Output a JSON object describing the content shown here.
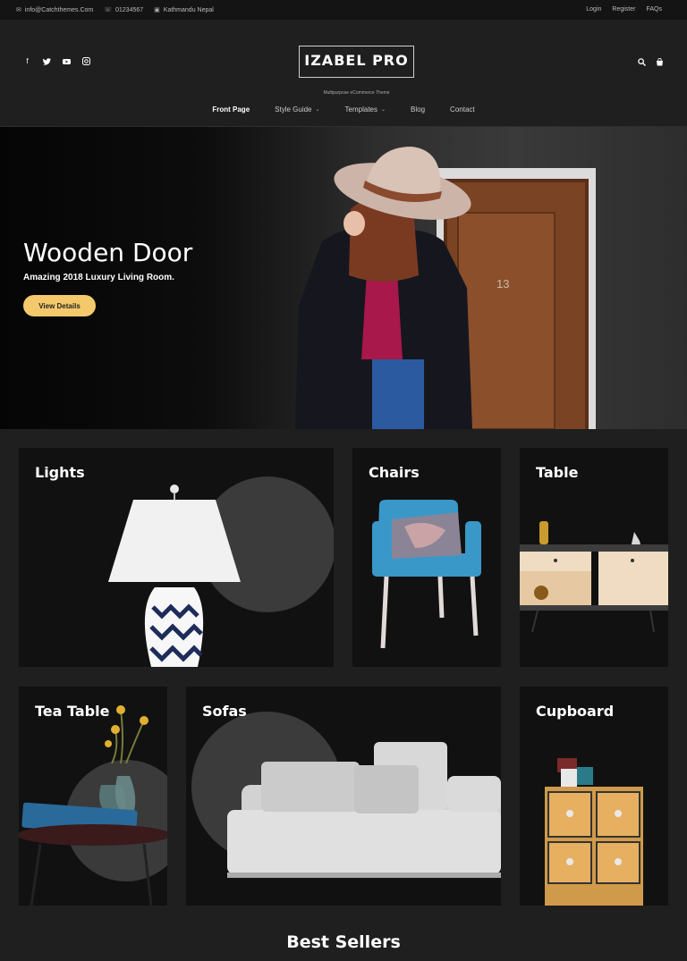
{
  "topbar": {
    "email": "info@Catchthemes.Com",
    "phone": "01234567",
    "location": "Kathmandu Nepal",
    "login": "Login",
    "register": "Register",
    "faqs": "FAQs"
  },
  "header": {
    "logo_name": "IZABEL PRO",
    "logo_tagline": "Multipurpose eCommerce Theme",
    "social_icons": [
      "facebook-icon",
      "twitter-icon",
      "youtube-icon",
      "instagram-icon"
    ],
    "nav": [
      {
        "label": "Front Page"
      },
      {
        "label": "Style Guide"
      },
      {
        "label": "Templates"
      },
      {
        "label": "Blog"
      },
      {
        "label": "Contact"
      }
    ]
  },
  "hero": {
    "title": "Wooden Door",
    "subtitle": "Amazing 2018 Luxury Living Room.",
    "button": "View Details",
    "door_number": "13"
  },
  "categories": [
    {
      "label": "Lights"
    },
    {
      "label": "Chairs"
    },
    {
      "label": "Table"
    },
    {
      "label": "Tea Table"
    },
    {
      "label": "Sofas"
    },
    {
      "label": "Cupboard"
    }
  ],
  "section_title": "Best Sellers",
  "colors": {
    "accent": "#f4c96b",
    "background": "#1f1f1f",
    "card": "#111111"
  }
}
